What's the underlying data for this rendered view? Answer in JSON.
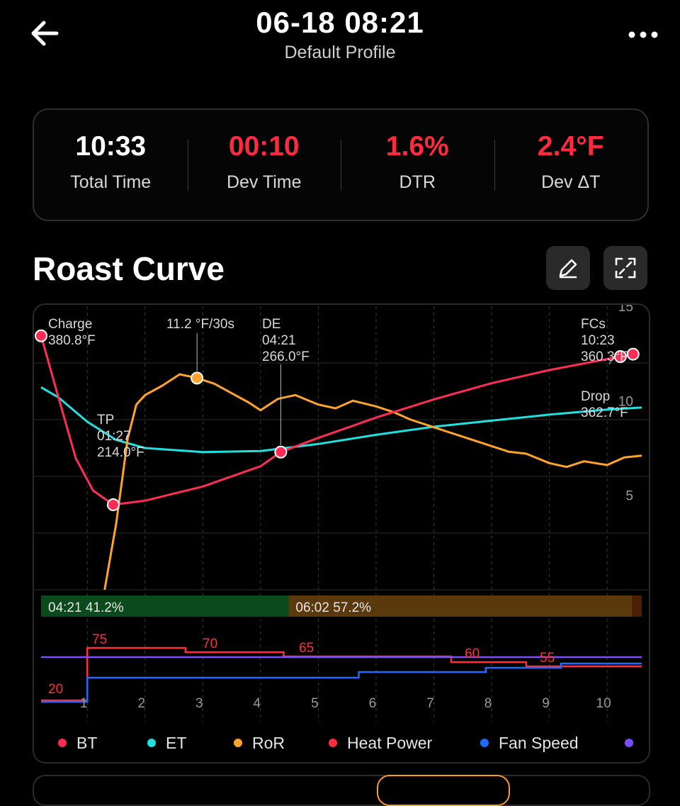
{
  "header": {
    "title": "06-18 08:21",
    "subtitle": "Default Profile",
    "back_icon": "arrow-left-icon",
    "more_icon": "more-horizontal-icon"
  },
  "stats": [
    {
      "value": "10:33",
      "label": "Total Time",
      "color": "#ffffff"
    },
    {
      "value": "00:10",
      "label": "Dev Time",
      "color": "#ff2a3d"
    },
    {
      "value": "1.6%",
      "label": "DTR",
      "color": "#ff2a3d"
    },
    {
      "value": "2.4°F",
      "label": "Dev ΔT",
      "color": "#ff2a3d"
    }
  ],
  "section": {
    "title": "Roast Curve",
    "edit_icon": "edit-pencil-icon",
    "expand_icon": "fullscreen-icon"
  },
  "chart_data": {
    "type": "line",
    "x_ticks": [
      "1",
      "2",
      "3",
      "4",
      "5",
      "6",
      "7",
      "8",
      "9",
      "10"
    ],
    "x_range": [
      0.2,
      10.6
    ],
    "ror_axis_ticks": [
      "15",
      "10",
      "5"
    ],
    "ror_range": [
      0,
      15
    ],
    "temp_range": [
      130,
      410
    ],
    "grid": true,
    "colors": {
      "BT": "#ff2d55",
      "ET": "#21e0e0",
      "RoR": "#ffa42b",
      "HeatPower": "#ff2d3d",
      "FanSpeed": "#1d6cff",
      "Extra": "#7c4dff"
    },
    "series": [
      {
        "name": "BT",
        "points": [
          [
            0.2,
            380.8
          ],
          [
            0.5,
            320
          ],
          [
            0.8,
            260
          ],
          [
            1.1,
            228
          ],
          [
            1.45,
            214.0
          ],
          [
            2.0,
            218
          ],
          [
            3.0,
            232
          ],
          [
            4.0,
            252
          ],
          [
            4.35,
            266.0
          ],
          [
            5,
            280
          ],
          [
            6,
            300
          ],
          [
            7,
            318
          ],
          [
            8,
            334
          ],
          [
            9,
            347
          ],
          [
            10.23,
            360.3
          ],
          [
            10.45,
            362.7
          ]
        ]
      },
      {
        "name": "ET",
        "points": [
          [
            0.2,
            330
          ],
          [
            0.5,
            320
          ],
          [
            1.0,
            296
          ],
          [
            1.5,
            278
          ],
          [
            2.0,
            270
          ],
          [
            3.0,
            266
          ],
          [
            4.0,
            267
          ],
          [
            5,
            274
          ],
          [
            6,
            283
          ],
          [
            7,
            291
          ],
          [
            8,
            297
          ],
          [
            9,
            303
          ],
          [
            10,
            308
          ],
          [
            10.6,
            310
          ]
        ]
      },
      {
        "name": "RoR",
        "points": [
          [
            1.3,
            0
          ],
          [
            1.5,
            3.5
          ],
          [
            1.7,
            8
          ],
          [
            1.85,
            9.8
          ],
          [
            2.0,
            10.3
          ],
          [
            2.3,
            10.8
          ],
          [
            2.6,
            11.4
          ],
          [
            2.9,
            11.2
          ],
          [
            3.2,
            10.9
          ],
          [
            3.5,
            10.4
          ],
          [
            3.8,
            9.9
          ],
          [
            4.0,
            9.5
          ],
          [
            4.3,
            10.1
          ],
          [
            4.6,
            10.3
          ],
          [
            5.0,
            9.8
          ],
          [
            5.3,
            9.6
          ],
          [
            5.6,
            10.0
          ],
          [
            6.0,
            9.7
          ],
          [
            6.3,
            9.4
          ],
          [
            6.6,
            9.0
          ],
          [
            7.0,
            8.6
          ],
          [
            7.3,
            8.3
          ],
          [
            7.6,
            8.0
          ],
          [
            8.0,
            7.6
          ],
          [
            8.3,
            7.3
          ],
          [
            8.6,
            7.2
          ],
          [
            9.0,
            6.7
          ],
          [
            9.3,
            6.5
          ],
          [
            9.6,
            6.8
          ],
          [
            10.0,
            6.6
          ],
          [
            10.3,
            7.0
          ],
          [
            10.6,
            7.1
          ]
        ]
      }
    ],
    "annotations": [
      {
        "label": "Charge",
        "time": "",
        "value": "380.8°F"
      },
      {
        "label": "11.2 °F/30s",
        "time": "",
        "value": ""
      },
      {
        "label": "DE",
        "time": "04:21",
        "value": "266.0°F"
      },
      {
        "label": "TP",
        "time": "01:27",
        "value": "214.0°F"
      },
      {
        "label": "FCs",
        "time": "10:23",
        "value": "360.3°F"
      },
      {
        "label": "Drop",
        "time": "",
        "value": "362.7°F"
      }
    ],
    "phases": [
      {
        "label": "04:21 41.2%",
        "color": "#0a4a1d",
        "fraction": 0.412
      },
      {
        "label": "06:02 57.2%",
        "color": "#5a3a0c",
        "fraction": 0.572
      },
      {
        "label": "",
        "color": "#4a1f06",
        "fraction": 0.016
      }
    ],
    "heat_power": {
      "values": [
        20,
        75,
        70,
        65,
        60,
        55
      ],
      "steps": [
        [
          0.2,
          20
        ],
        [
          1.0,
          75
        ],
        [
          2.7,
          70
        ],
        [
          4.4,
          65
        ],
        [
          7.3,
          60
        ],
        [
          8.6,
          55
        ],
        [
          10.6,
          55
        ]
      ]
    },
    "fan_speed": {
      "steps": [
        [
          0.2,
          0
        ],
        [
          1.0,
          1
        ],
        [
          5.7,
          2
        ],
        [
          7.9,
          3
        ],
        [
          9.2,
          4
        ],
        [
          10.6,
          4
        ]
      ]
    },
    "extra_line": {
      "level": 1
    }
  },
  "legend": [
    {
      "label": "BT",
      "color": "#ff2d55"
    },
    {
      "label": "ET",
      "color": "#21e0e0"
    },
    {
      "label": "RoR",
      "color": "#ffa42b"
    },
    {
      "label": "Heat Power",
      "color": "#ff2d3d"
    },
    {
      "label": "Fan Speed",
      "color": "#1d6cff"
    },
    {
      "label": "",
      "color": "#7c4dff"
    }
  ]
}
